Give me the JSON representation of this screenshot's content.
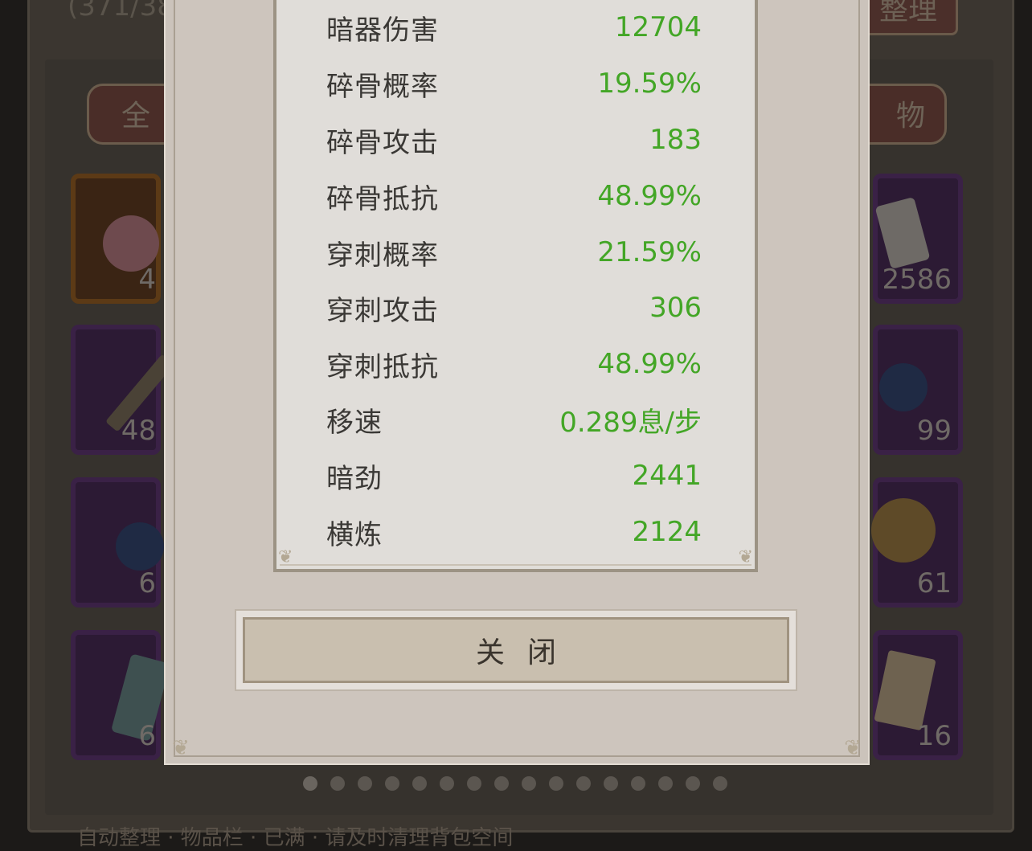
{
  "background": {
    "item_count": "(371/38",
    "sort_button": "整理",
    "tab_all": "全",
    "tab_item": "物",
    "left_slots": [
      {
        "count": "4",
        "icon": "pearls-icon"
      },
      {
        "count": "48",
        "icon": "dagger-icon"
      },
      {
        "count": "6",
        "icon": "sapphire-icon"
      },
      {
        "count": "6",
        "icon": "jade-token-icon"
      }
    ],
    "right_slots": [
      {
        "count": "2586",
        "icon": "scroll-stone-icon"
      },
      {
        "count": "99",
        "icon": "sapphire-icon"
      },
      {
        "count": "61",
        "icon": "coin-icon"
      },
      {
        "count": "16",
        "icon": "parchment-icon"
      }
    ],
    "pager_dots": 16,
    "pager_active": 0,
    "bottom_text": "自动整理 · 物品栏 · 已满 · 请及时清理背包空间"
  },
  "dialog": {
    "stats": [
      {
        "label": "暗器伤害",
        "value": "12704"
      },
      {
        "label": "碎骨概率",
        "value": "19.59%"
      },
      {
        "label": "碎骨攻击",
        "value": "183"
      },
      {
        "label": "碎骨抵抗",
        "value": "48.99%"
      },
      {
        "label": "穿刺概率",
        "value": "21.59%"
      },
      {
        "label": "穿刺攻击",
        "value": "306"
      },
      {
        "label": "穿刺抵抗",
        "value": "48.99%"
      },
      {
        "label": "移速",
        "value": "0.289息/步"
      },
      {
        "label": "暗劲",
        "value": "2441"
      },
      {
        "label": "横炼",
        "value": "2124"
      }
    ],
    "close_button": "关闭"
  },
  "colors": {
    "stat_value": "#43a626",
    "stat_label": "#3a3835",
    "dialog_bg": "#cbc3bb",
    "panel_bg": "#e0ddd9"
  }
}
